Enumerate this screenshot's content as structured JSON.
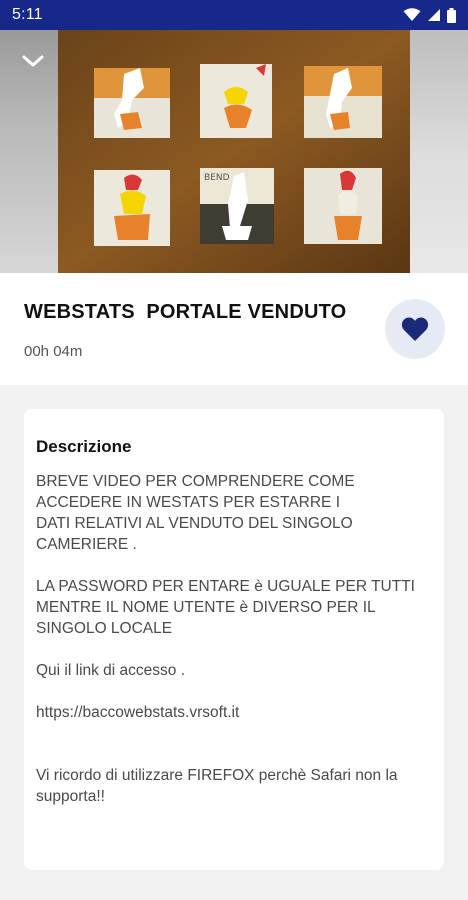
{
  "status_bar": {
    "time": "5:11",
    "icons": [
      "wifi-icon",
      "signal-icon",
      "battery-icon"
    ],
    "background": "#16288a"
  },
  "hero": {
    "back_icon": "chevron-down-icon"
  },
  "video": {
    "title": "WEBSTATS  PORTALE VENDUTO",
    "duration": "00h 04m",
    "favorite_icon": "heart-icon",
    "favorite_color": "#1b2a78"
  },
  "description": {
    "heading": "Descrizione",
    "body": "BREVE VIDEO PER COMPRENDERE COME ACCEDERE IN WESTATS PER ESTARRE I\nDATI RELATIVI AL VENDUTO DEL SINGOLO CAMERIERE .\n\nLA PASSWORD PER ENTARE è UGUALE PER TUTTI MENTRE IL NOME UTENTE è DIVERSO PER IL SINGOLO LOCALE\n\nQui il link di accesso .\n\nhttps://baccowebstats.vrsoft.it\n\n\nVi ricordo di utilizzare FIREFOX perchè Safari non la supporta!!"
  }
}
